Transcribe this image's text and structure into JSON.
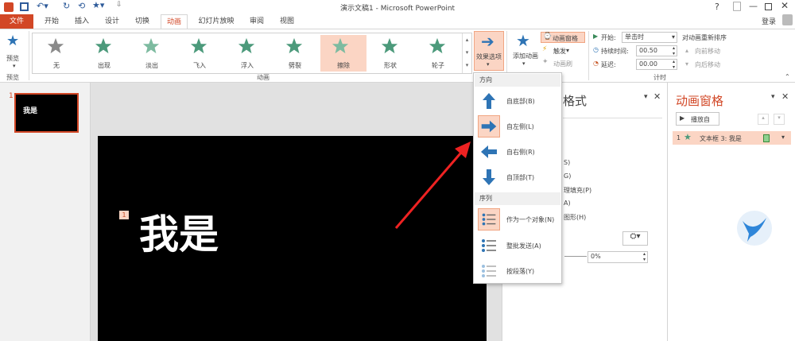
{
  "window": {
    "title": "演示文稿1 - Microsoft PowerPoint",
    "login": "登录",
    "help": "?"
  },
  "tabs": [
    {
      "label": "文件"
    },
    {
      "label": "开始"
    },
    {
      "label": "插入"
    },
    {
      "label": "设计"
    },
    {
      "label": "切换"
    },
    {
      "label": "动画"
    },
    {
      "label": "幻灯片放映"
    },
    {
      "label": "审阅"
    },
    {
      "label": "视图"
    }
  ],
  "ribbon": {
    "preview": {
      "label": "预览",
      "group": "预览"
    },
    "gallery_group": "动画",
    "gallery": [
      {
        "label": "无"
      },
      {
        "label": "出现"
      },
      {
        "label": "淡出"
      },
      {
        "label": "飞入"
      },
      {
        "label": "浮入"
      },
      {
        "label": "劈裂"
      },
      {
        "label": "擦除"
      },
      {
        "label": "形状"
      },
      {
        "label": "轮子"
      }
    ],
    "effect_options": "效果选项",
    "add_animation": "添加动画",
    "animation_pane": "动画窗格",
    "trigger": "触发",
    "painter": "动画刷",
    "timing": {
      "group": "计时",
      "start_label": "开始:",
      "start_value": "单击时",
      "duration_label": "持续时间:",
      "duration_value": "00.50",
      "delay_label": "延迟:",
      "delay_value": "00.00",
      "reorder": "对动画重新排序",
      "move_earlier": "向前移动",
      "move_later": "向后移动"
    }
  },
  "thumbnail": {
    "number": "1",
    "text": "我是"
  },
  "slide": {
    "text": "我是",
    "anim_tag": "1"
  },
  "dropdown": {
    "direction_header": "方向",
    "directions": [
      {
        "label": "自底部(B)"
      },
      {
        "label": "自左侧(L)"
      },
      {
        "label": "自右侧(R)"
      },
      {
        "label": "自顶部(T)"
      }
    ],
    "sequence_header": "序列",
    "sequences": [
      {
        "label": "作为一个对象(N)"
      },
      {
        "label": "整批发送(A)"
      },
      {
        "label": "按段落(Y)"
      }
    ]
  },
  "format_pane": {
    "title": "格式",
    "opt1": "S)",
    "opt2": "G)",
    "opt3": "理填充(P)",
    "opt4": "A)",
    "opt5": "图形(H)",
    "percent": "0%"
  },
  "anim_pane": {
    "title": "动画窗格",
    "play_btn": "播放自",
    "item_num": "1",
    "item_label": "文本框 3: 我是"
  },
  "colors": {
    "accent": "#d24726",
    "selected": "#fbd5c4",
    "arrow_blue": "#2e74b5"
  }
}
